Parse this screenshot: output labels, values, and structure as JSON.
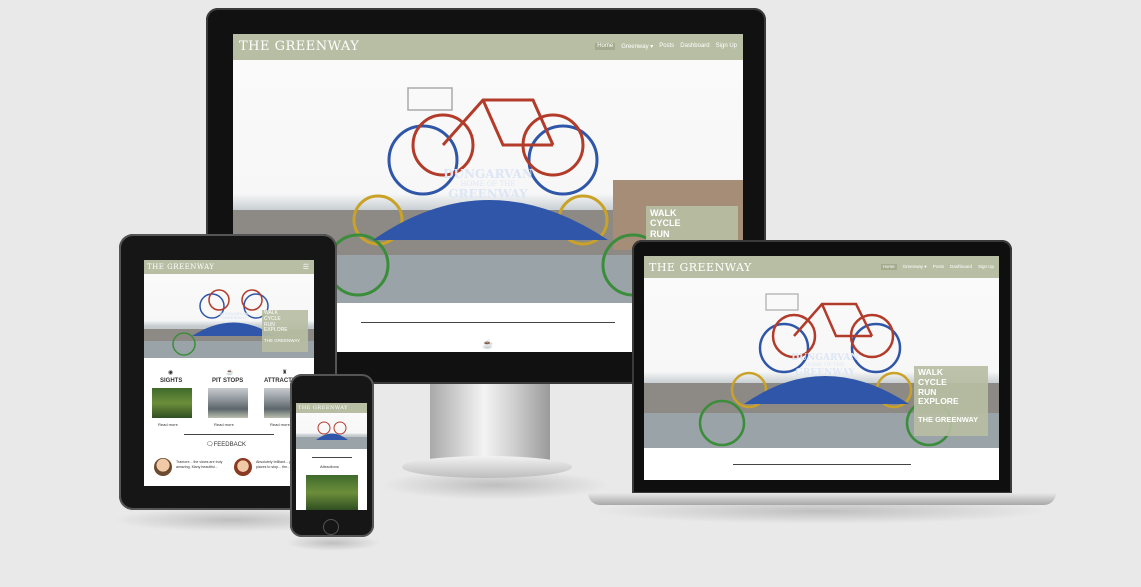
{
  "brand": "THE GREENWAY",
  "nav": {
    "items": [
      "Home",
      "Greenway",
      "Posts",
      "Dashboard",
      "Sign Up"
    ],
    "active": "Home",
    "greenway_dropdown": "Greenway ▾"
  },
  "hero": {
    "sign_line1": "DUNGARVAN",
    "sign_line2": "HOME OF THE",
    "sign_line3": "GREENWAY",
    "tagline": [
      "WALK",
      "CYCLE",
      "RUN",
      "EXPLORE"
    ],
    "tag_cta": "THE GREENWAY"
  },
  "sections": {
    "sights": "SIGHTS",
    "pit_stops": "PIT STOPS",
    "attractions": "ATTRACTI",
    "feedback": "FEEDBACK",
    "phone_section": "Attractions"
  },
  "card_links": [
    "Read more",
    "Read more",
    "Read more"
  ],
  "feedback": {
    "left": "Tramore... the views are truly amazing. Many beautiful...",
    "right": "Absolutely brilliant... plenty of places to stop... the..."
  },
  "colors": {
    "nav": "#b7bea3",
    "background": "#e9e9e9",
    "sign_blue": "#2f56a8"
  },
  "icons": [
    "menu-icon",
    "coffee-icon",
    "binoculars-icon",
    "mug-icon",
    "castle-icon",
    "chat-icon"
  ]
}
